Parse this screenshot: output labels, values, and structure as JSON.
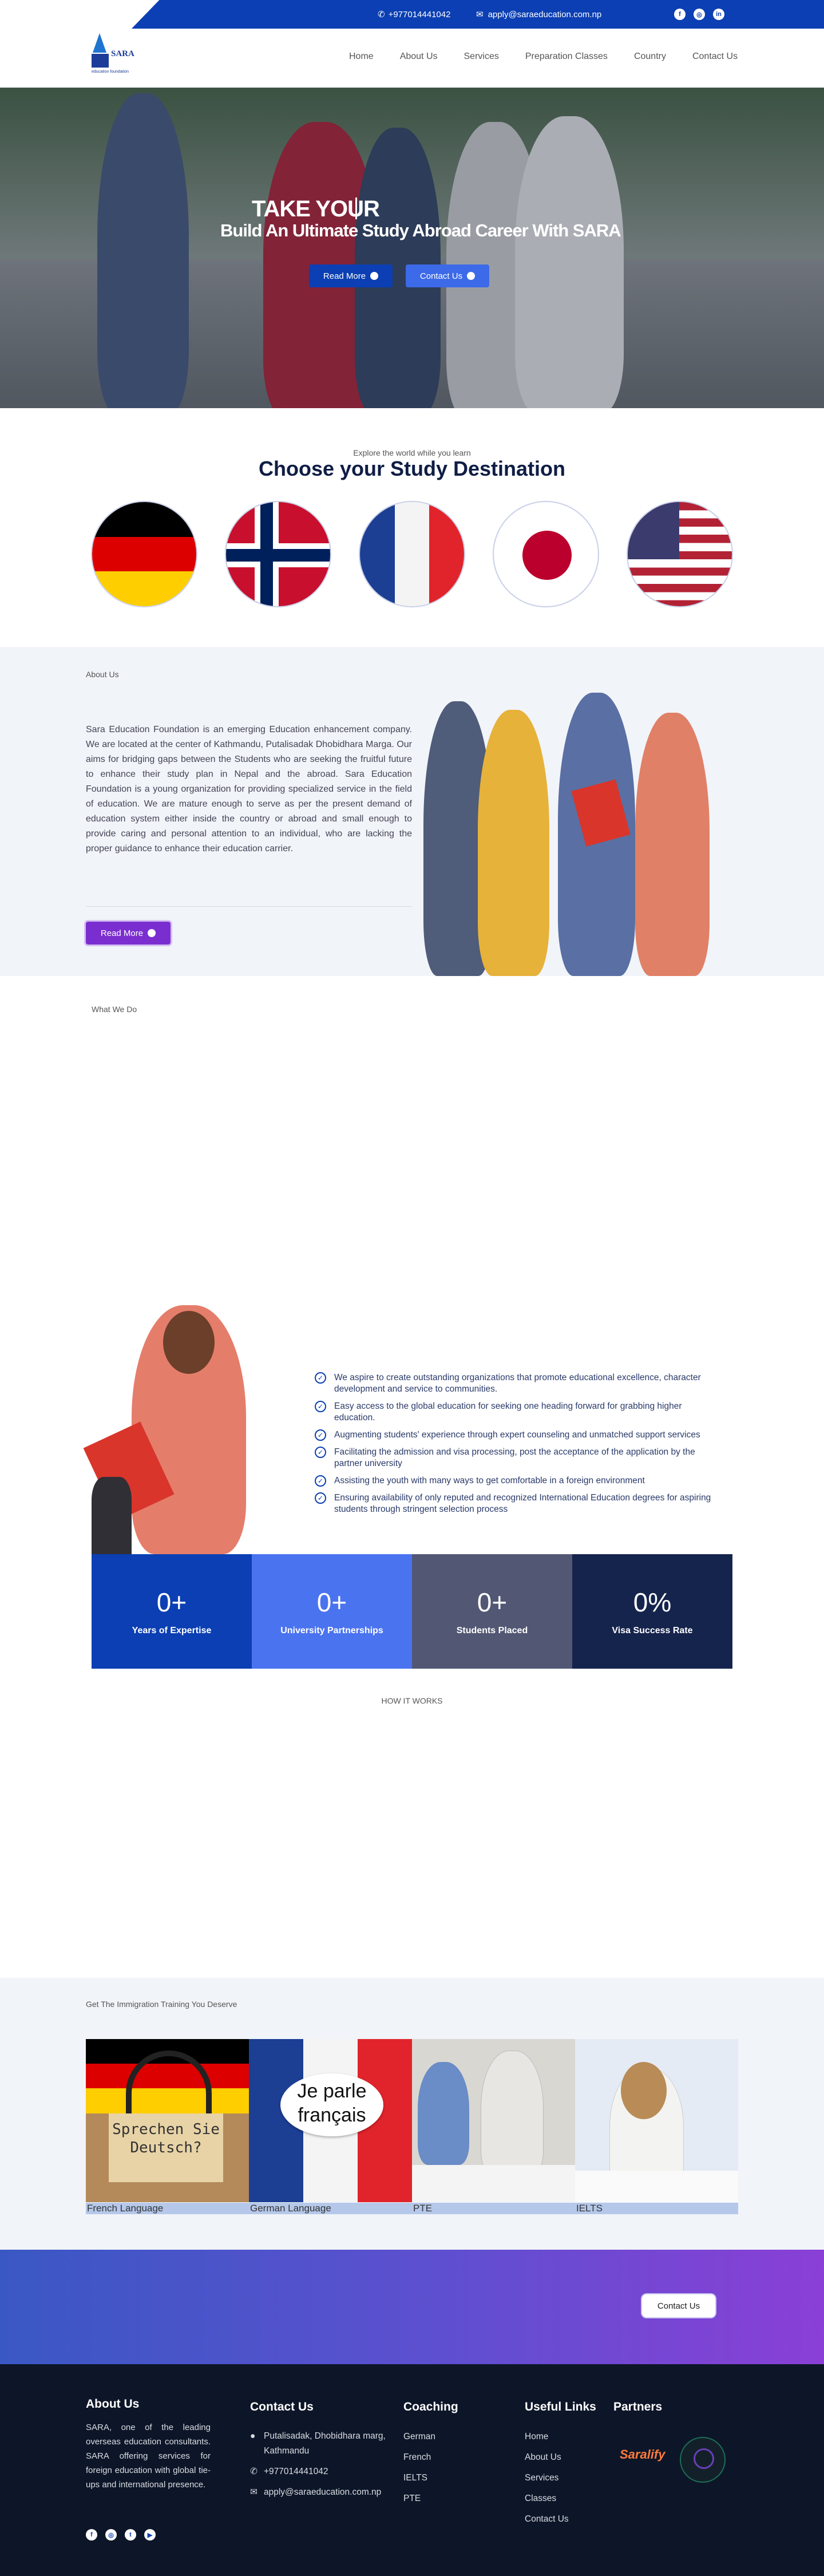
{
  "topbar": {
    "phone": "+97701444104​2",
    "email": "apply@saraeducation.com.np",
    "social": [
      {
        "icon": "facebook-icon",
        "glyph": "f"
      },
      {
        "icon": "instagram-icon",
        "glyph": "◎"
      },
      {
        "icon": "linkedin-icon",
        "glyph": "in"
      }
    ]
  },
  "logo": {
    "text": "SARA",
    "tagline": "education foundation"
  },
  "nav": {
    "items": [
      "Home",
      "About Us",
      "Services",
      "Preparation Classes",
      "Country",
      "Contact Us"
    ]
  },
  "hero": {
    "title_line1": "TAKE YOUR",
    "title_line2": "Build An Ultimate Study Abroad Career With SARA",
    "read_more": "Read More",
    "contact_us": "Contact Us"
  },
  "destinations": {
    "eyebrow": "Explore the world while you learn",
    "title": "Choose your Study Destination",
    "flags": [
      "germany-flag",
      "norway-flag",
      "france-flag",
      "japan-flag",
      "usa-flag"
    ]
  },
  "about": {
    "label": "About Us",
    "body": "Sara Education Foundation is an emerging Education enhancement company. We are located at the center of Kathmandu, Putalisadak Dhobidhara Marga. Our aims for bridging gaps between the Students who are seeking the fruitful future to enhance their study plan in Nepal and the abroad. Sara Education Foundation is a young organization for providing specialized service in the field of education. We are mature enough to serve as per the present demand of education system either inside the country or abroad and small enough to provide caring and personal attention to an individual, who are lacking the proper guidance to enhance their education carrier.",
    "button": "Read More"
  },
  "what_we_do": {
    "label": "What We Do",
    "bullets": [
      "We aspire to create outstanding organizations that promote educational excellence, character development and service to communities.",
      "Easy access to the global education for seeking one heading forward for grabbing higher education.",
      "Augmenting students' experience through expert counseling and unmatched support services",
      "Facilitating the admission and visa processing, post the acceptance of the application by the partner university",
      "Assisting the youth with many ways to get comfortable in a foreign environment",
      "Ensuring availability of only reputed and recognized International Education degrees for aspiring students through stringent selection process"
    ]
  },
  "stats": [
    {
      "value": "0+",
      "label": "Years of Expertise",
      "color": "#0b3fb3"
    },
    {
      "value": "0+",
      "label": "University Partnerships",
      "color": "#4a73f0"
    },
    {
      "value": "0+",
      "label": "Students Placed",
      "color": "#525773"
    },
    {
      "value": "0%",
      "label": "Visa Success Rate",
      "color": "#15244d"
    }
  ],
  "how_it_works": {
    "label": "HOW IT WORKS"
  },
  "training": {
    "label": "Get The Immigration Training You Deserve",
    "courses": [
      {
        "label": "French Language",
        "sign": "Sprechen Sie Deutsch?"
      },
      {
        "label": "German Language",
        "sign": "Je parle français"
      },
      {
        "label": "PTE"
      },
      {
        "label": "IELTS"
      }
    ]
  },
  "cta": {
    "button": "Contact Us"
  },
  "footer": {
    "about_title": "About Us",
    "about_text": "SARA, one of the leading overseas education consultants. SARA offering services for foreign education with global tie-ups and international presence.",
    "contact_title": "Contact Us",
    "address": "Putalisadak, Dhobidhara marg, Kathmandu",
    "phone": "+977014441042",
    "email": "apply@saraeducation.com.np",
    "coaching_title": "Coaching",
    "coaching": [
      "German",
      "French",
      "IELTS",
      "PTE"
    ],
    "links_title": "Useful Links",
    "links": [
      "Home",
      "About Us",
      "Services",
      "Classes",
      "Contact Us"
    ],
    "partners_title": "Partners",
    "partner_logo_text": "Saralify"
  }
}
